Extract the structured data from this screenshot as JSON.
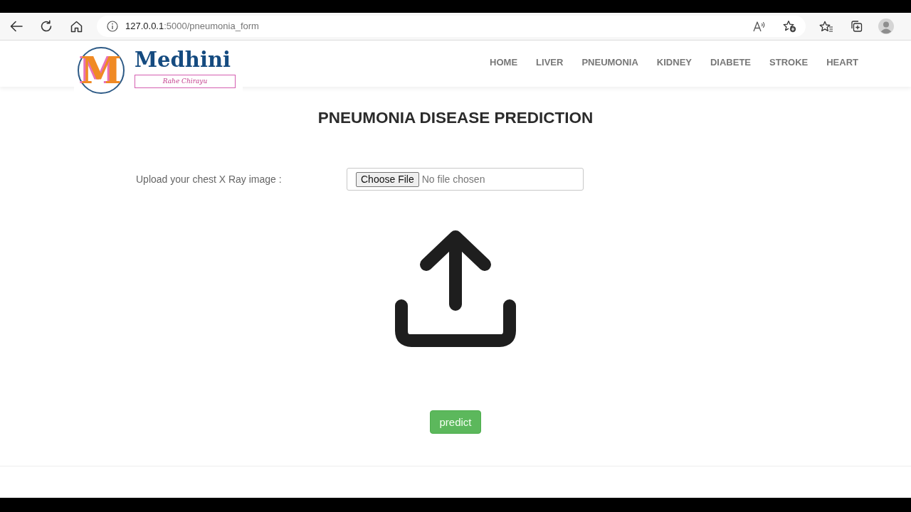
{
  "browser": {
    "url_host": "127.0.0.1",
    "url_path": ":5000/pneumonia_form"
  },
  "brand": {
    "mark": "M",
    "name": "Medhini",
    "tagline": "Rahe Chirayu"
  },
  "nav": [
    "HOME",
    "LIVER",
    "PNEUMONIA",
    "KIDNEY",
    "DIABETE",
    "STROKE",
    "HEART"
  ],
  "title": "PNEUMONIA DISEASE PREDICTION",
  "upload": {
    "label": "Upload your chest X Ray image :",
    "button": "Choose File",
    "status": "No file chosen"
  },
  "predict_button": "predict"
}
